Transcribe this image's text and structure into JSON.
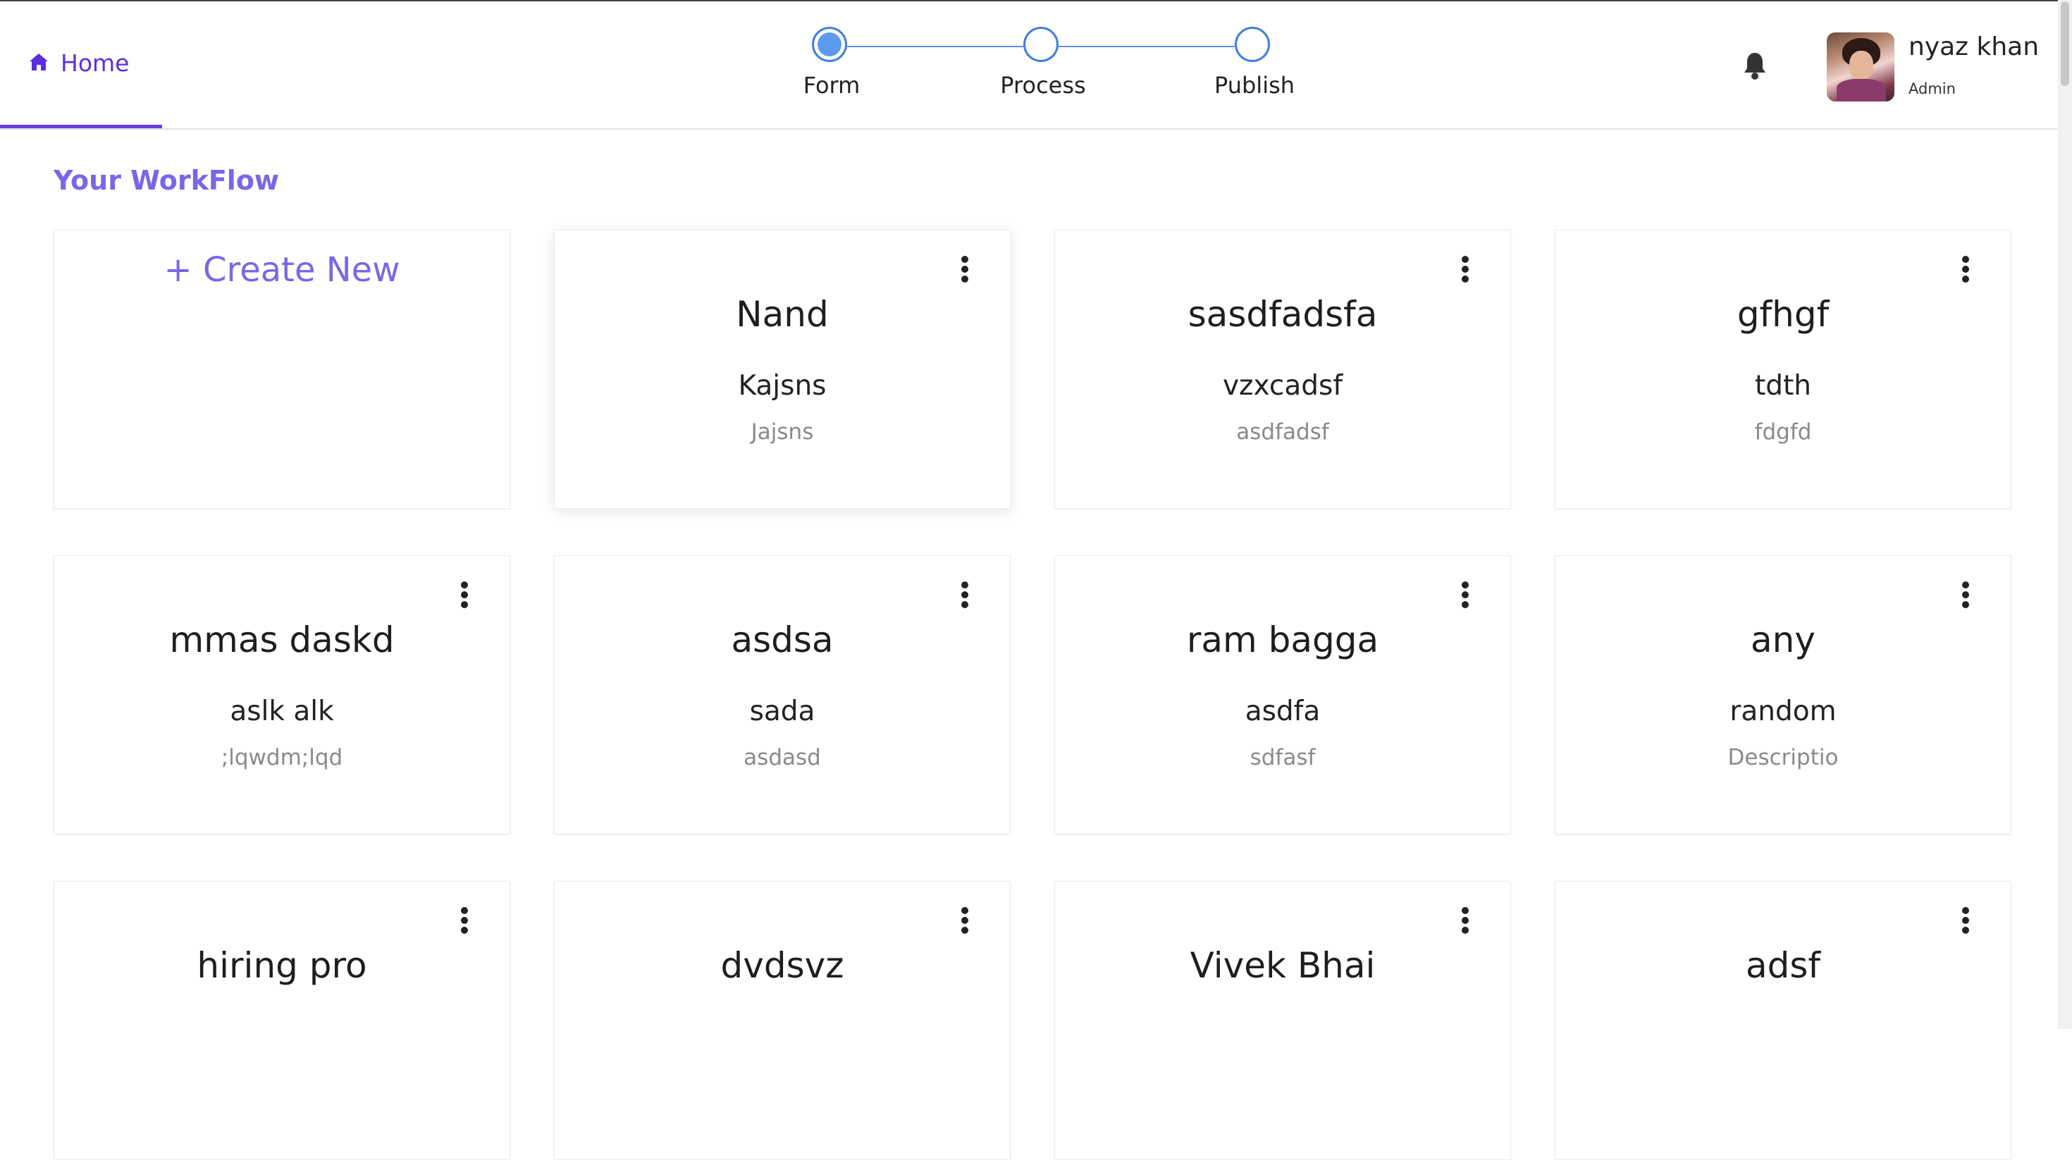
{
  "nav": {
    "home_label": "Home"
  },
  "stepper": {
    "steps": [
      {
        "label": "Form"
      },
      {
        "label": "Process"
      },
      {
        "label": "Publish"
      }
    ],
    "active_index": 0
  },
  "user": {
    "name": "nyaz khan",
    "role": "Admin"
  },
  "main": {
    "section_title": "Your WorkFlow",
    "create_label": "+ Create New",
    "cards": [
      {
        "title": "Nand",
        "subtitle": "Kajsns",
        "description": "Jajsns"
      },
      {
        "title": "sasdfadsfa",
        "subtitle": "vzxcadsf",
        "description": "asdfadsf"
      },
      {
        "title": "gfhgf",
        "subtitle": "tdth",
        "description": "fdgfd"
      },
      {
        "title": "mmas daskd",
        "subtitle": "aslk alk",
        "description": ";lqwdm;lqd"
      },
      {
        "title": "asdsa",
        "subtitle": "sada",
        "description": "asdasd"
      },
      {
        "title": "ram bagga",
        "subtitle": "asdfa",
        "description": "sdfasf"
      },
      {
        "title": "any",
        "subtitle": "random",
        "description": "Descriptio"
      },
      {
        "title": "hiring pro",
        "subtitle": "",
        "description": ""
      },
      {
        "title": "dvdsvz",
        "subtitle": "",
        "description": ""
      },
      {
        "title": "Vivek Bhai",
        "subtitle": "",
        "description": ""
      },
      {
        "title": "adsf",
        "subtitle": "",
        "description": ""
      }
    ]
  },
  "icons": {
    "home": "home-icon",
    "bell": "bell-icon",
    "menu": "more-vertical-icon"
  },
  "colors": {
    "accent": "#6a3fe0",
    "title_purple": "#7b66e8",
    "step_blue": "#3f7ee0"
  }
}
